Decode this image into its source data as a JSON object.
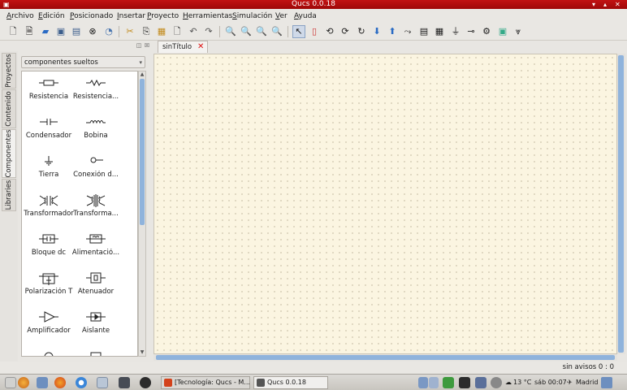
{
  "window": {
    "title": "Qucs 0.0.18"
  },
  "menu": [
    "Archivo",
    "Edición",
    "Posicionado",
    "Insertar",
    "Proyecto",
    "Herramientas",
    "Simulación",
    "Ver",
    "Ayuda"
  ],
  "side_tabs": [
    "Proyectos",
    "Contenido",
    "Componentes",
    "Libraries"
  ],
  "components": {
    "category": "componentes sueltos",
    "items": [
      "Resistencia",
      "Resistencia...",
      "Condensador",
      "Bobina",
      "Tierra",
      "Conexión d...",
      "Transformador",
      "Transforma...",
      "Bloque dc",
      "Alimentació...",
      "Polarización T",
      "Atenuador",
      "Amplificador",
      "Aislante"
    ]
  },
  "document": {
    "tab_label": "sinTítulo"
  },
  "statusbar": {
    "text": "sin avisos 0 : 0"
  },
  "taskbar": {
    "tasks": [
      "[Tecnología: Qucs - M...",
      "Qucs 0.0.18"
    ],
    "weather": "13 °C",
    "clock": "sáb 00:07",
    "location": "Madrid"
  },
  "colors": {
    "titlebar": "#b00d0d",
    "canvas": "#fbf5e1",
    "scroll_thumb": "#8fb3dc",
    "close_tab": "#dd1111"
  }
}
